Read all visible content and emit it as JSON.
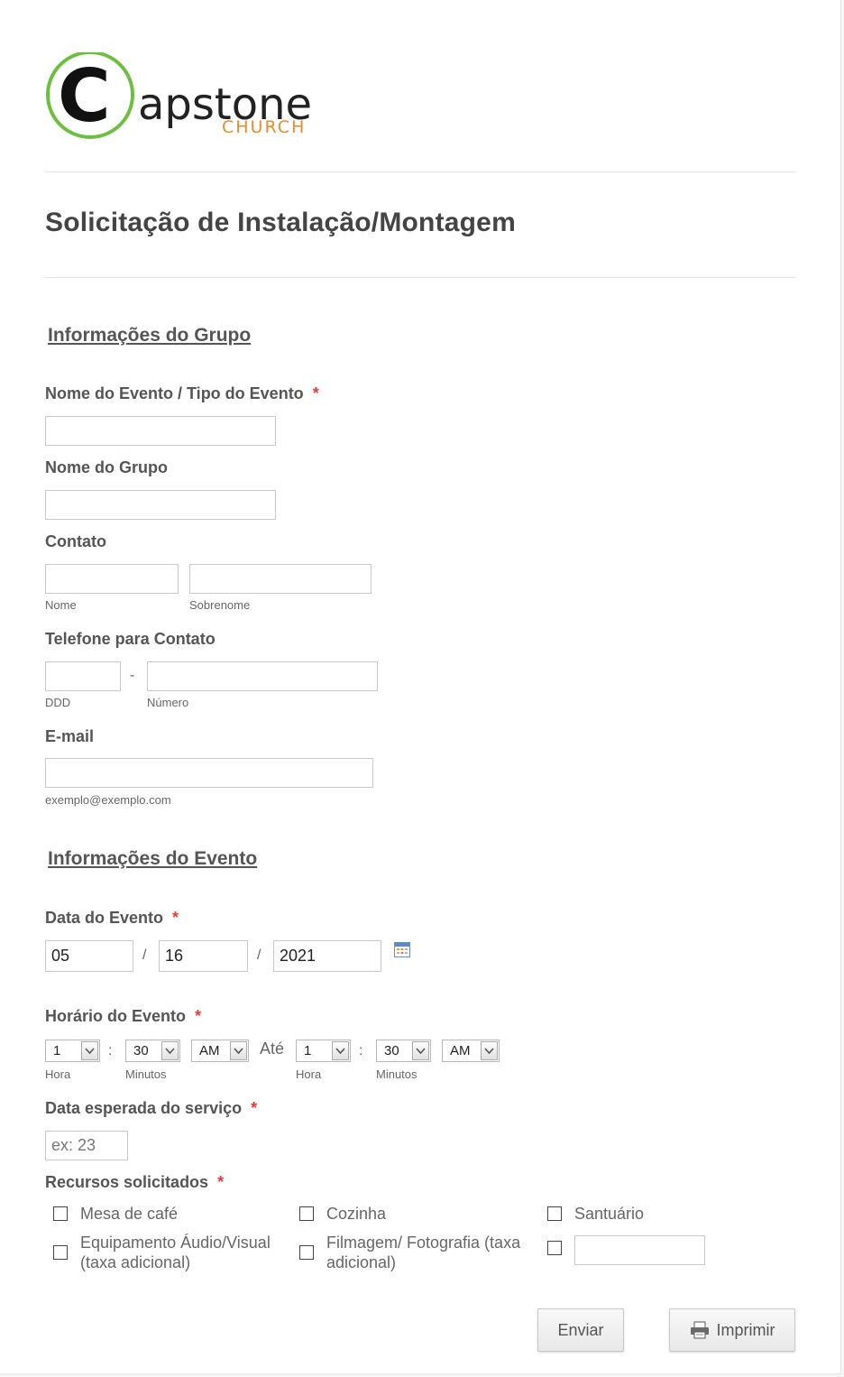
{
  "logo": {
    "main": "apstone",
    "sub": "CHURCH"
  },
  "form": {
    "title": "Solicitação de Instalação/Montagem"
  },
  "section_group": {
    "heading": "Informações do Grupo"
  },
  "fields": {
    "event_name": {
      "label": "Nome do Evento / Tipo do Evento",
      "required": "*"
    },
    "group_name": {
      "label": "Nome do Grupo"
    },
    "contact": {
      "label": "Contato",
      "first_sub": "Nome",
      "last_sub": "Sobrenome"
    },
    "phone": {
      "label": "Telefone para Contato",
      "sep": "-",
      "ddd_sub": "DDD",
      "number_sub": "Número"
    },
    "email": {
      "label": "E-mail",
      "sub": "exemplo@exemplo.com"
    }
  },
  "section_event": {
    "heading": "Informações do Evento"
  },
  "event_date": {
    "label": "Data do Evento",
    "required": "*",
    "month": "05",
    "day": "16",
    "year": "2021",
    "sep": "/"
  },
  "event_time": {
    "label": "Horário do Evento",
    "required": "*",
    "colon": ":",
    "until": "Até",
    "hour_sub": "Hora",
    "minutes_sub": "Minutos",
    "start": {
      "hour": "1",
      "minutes": "30",
      "ampm": "AM"
    },
    "end": {
      "hour": "1",
      "minutes": "30",
      "ampm": "AM"
    }
  },
  "service_date": {
    "label": "Data esperada do serviço",
    "required": "*",
    "placeholder": "ex: 23"
  },
  "resources": {
    "label": "Recursos solicitados",
    "required": "*",
    "options": [
      "Mesa de café",
      "Cozinha",
      "Santuário",
      "Equipamento Áudio/Visual (taxa adicional)",
      "Filmagem/ Fotografia (taxa adicional)"
    ]
  },
  "buttons": {
    "submit": "Enviar",
    "print": "Imprimir"
  },
  "colors": {
    "logo_green": "#6cbf3f",
    "logo_orange": "#f08a2e",
    "required": "#e63b3b"
  }
}
